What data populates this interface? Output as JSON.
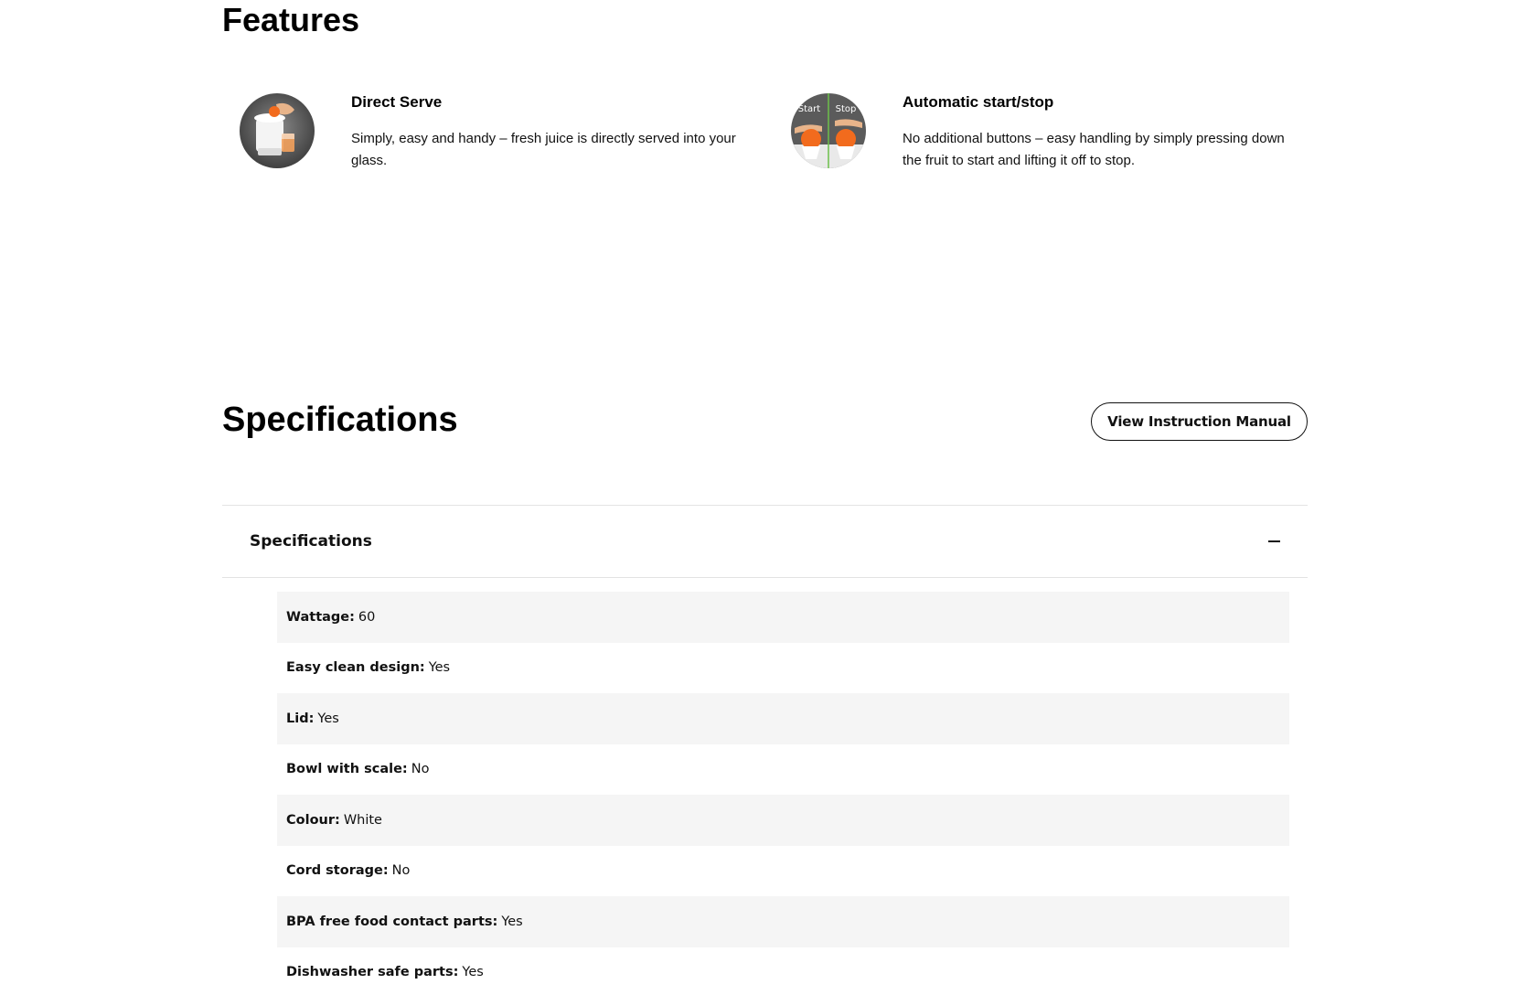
{
  "features": {
    "title": "Features",
    "items": [
      {
        "title": "Direct Serve",
        "description": "Simply, easy and handy – fresh juice is directly served into your glass.",
        "icon": "juicer-direct-serve-image"
      },
      {
        "title": "Automatic start/stop",
        "description": "No additional buttons – easy handling by simply pressing down the fruit to start and lifting it off to stop.",
        "icon": "start-stop-image",
        "image_labels": {
          "start": "Start",
          "stop": "Stop"
        }
      }
    ]
  },
  "specifications": {
    "title": "Specifications",
    "manual_button": "View Instruction Manual",
    "accordion_label": "Specifications",
    "rows": [
      {
        "key": "Wattage:",
        "value": "60"
      },
      {
        "key": "Easy clean design:",
        "value": "Yes"
      },
      {
        "key": "Lid:",
        "value": "Yes"
      },
      {
        "key": "Bowl with scale:",
        "value": "No"
      },
      {
        "key": "Colour:",
        "value": "White"
      },
      {
        "key": "Cord storage:",
        "value": "No"
      },
      {
        "key": "BPA free food contact parts:",
        "value": "Yes"
      },
      {
        "key": "Dishwasher safe parts:",
        "value": "Yes"
      }
    ]
  },
  "colors": {
    "row_shade": "#f5f5f5",
    "text": "#111111",
    "accent_orange": "#f26b1d"
  }
}
